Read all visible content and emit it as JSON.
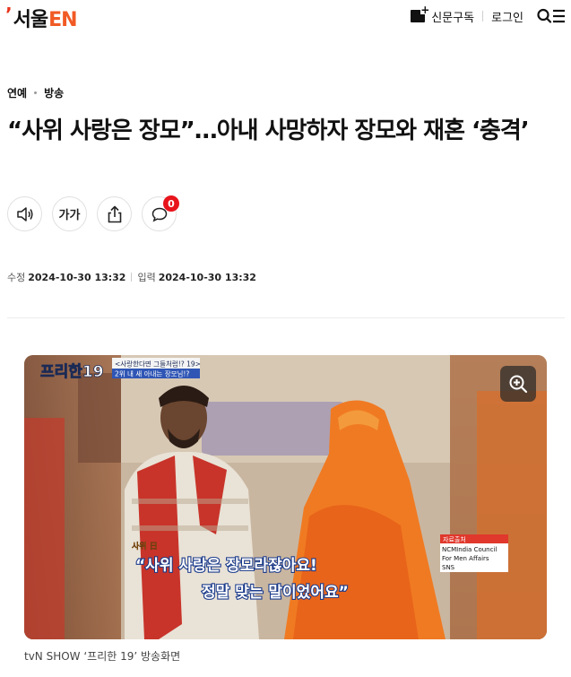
{
  "header": {
    "logo_text": "서울",
    "logo_en": "EN",
    "subscribe_label": "신문구독",
    "login_label": "로그인"
  },
  "article": {
    "category": "연예",
    "subcategory": "방송",
    "title": "“사위 사랑은 장모”…아내 사망하자 장모와 재혼 ‘충격’",
    "font_button_label": "가가",
    "comment_count": "0",
    "modified_label": "수정",
    "modified_value": "2024-10-30 13:32",
    "published_label": "입력",
    "published_value": "2024-10-30 13:32"
  },
  "photo": {
    "show_logo": "프리한19",
    "banner_line1": "<사랑한다면 그들처럼!? 19>",
    "banner_line2": "2위 내 새 아내는 장모님!?",
    "speaker_tag": "사위 日",
    "subtitle_line1": "“사위 사랑은 장모라잖아요!",
    "subtitle_line2": "정말 맞는 말이었어요”",
    "source_label": "자료출처",
    "source_text_line1": "NCMIndia Council",
    "source_text_line2": "For Men Affairs",
    "source_text_line3": "SNS",
    "caption": "tvN SHOW ‘프리한 19’ 방송화면"
  },
  "colors": {
    "brand_red": "#e8341c",
    "brand_orange": "#f15a24",
    "badge": "#e8141c"
  }
}
